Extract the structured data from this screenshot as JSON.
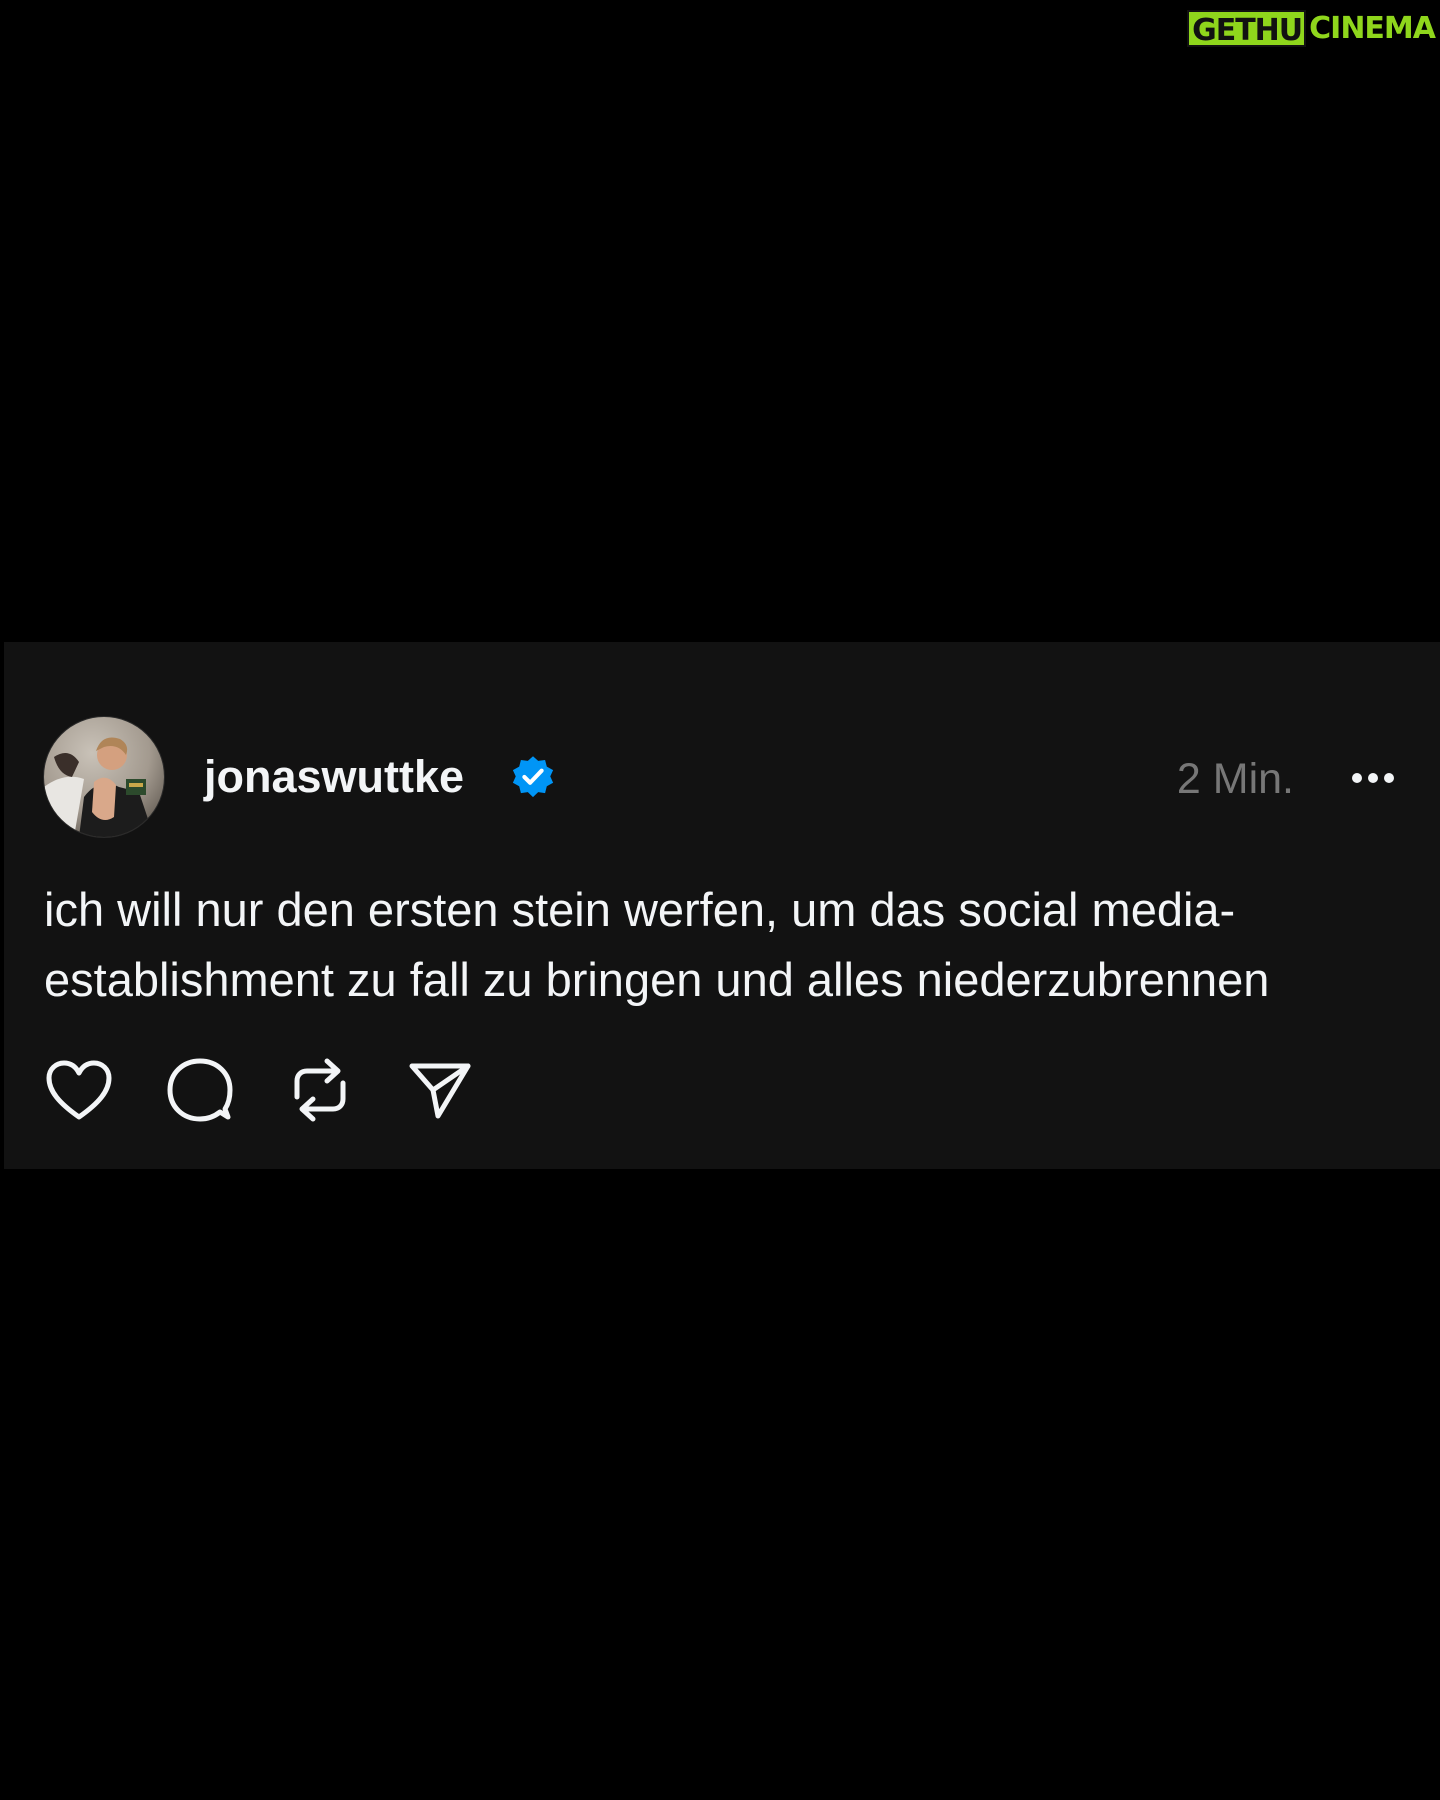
{
  "watermark": {
    "left": "GETHU",
    "right": "CINEMA"
  },
  "post": {
    "username": "jonaswuttke",
    "verified": true,
    "timestamp": "2 Min.",
    "text": "ich will nur den ersten stein werfen, um das social media-\nestablishment zu fall zu bringen und alles niederzubrennen"
  },
  "icons": {
    "avatar": "profile-photo",
    "verified": "verified-badge-icon",
    "more": "more-options-icon",
    "like": "heart-icon",
    "comment": "comment-bubble-icon",
    "repost": "repost-icon",
    "share": "send-icon"
  },
  "colors": {
    "page_background": "#000000",
    "card_background": "#121212",
    "primary_text": "#f3f5f7",
    "secondary_text": "#777777",
    "verified_blue": "#0095f6",
    "watermark_green": "#8fd61c"
  }
}
